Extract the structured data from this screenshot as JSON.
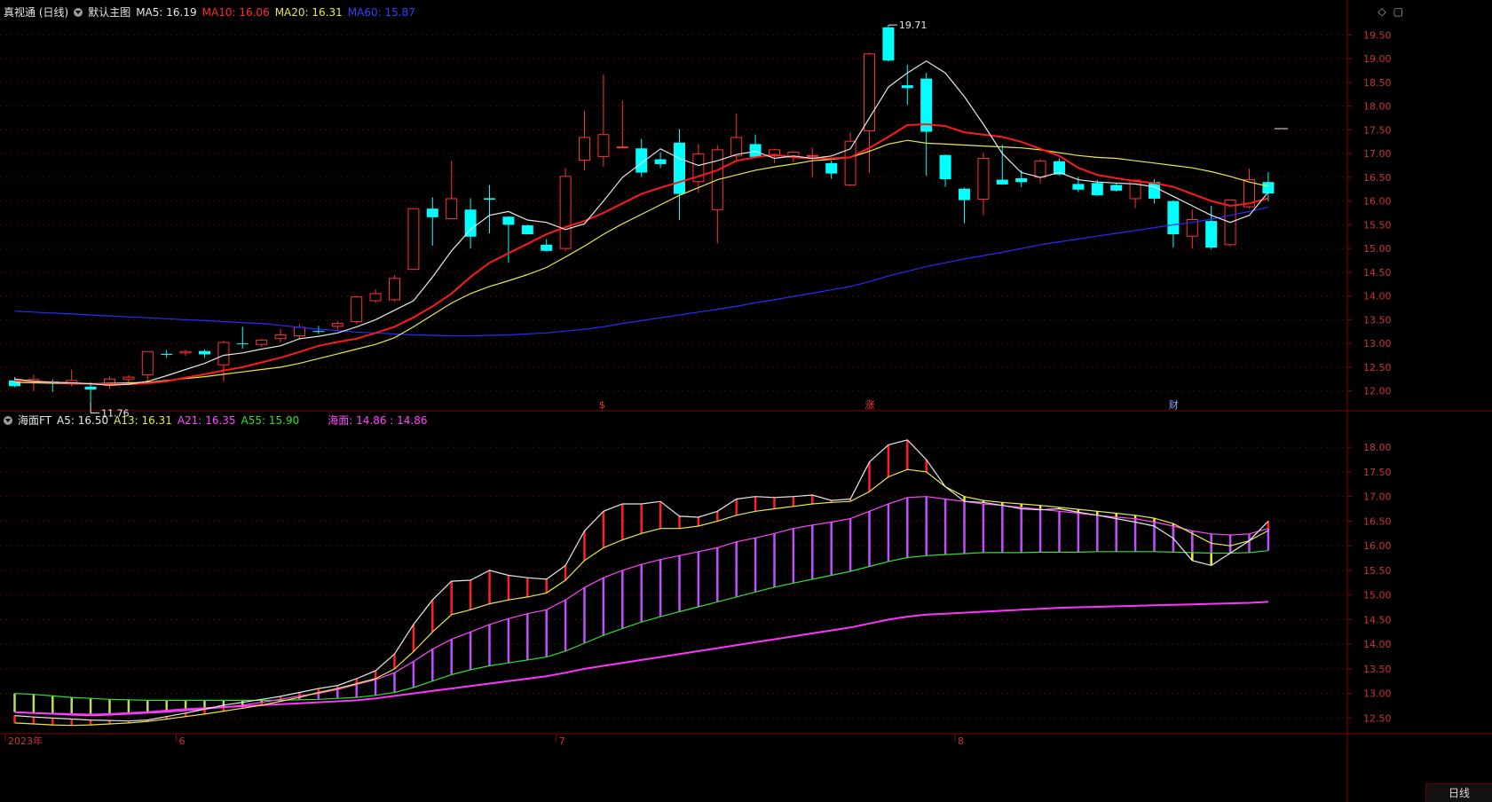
{
  "top_panel": {
    "title": "真视通 (日线)",
    "template": "默认主图",
    "ma": [
      {
        "label": "MA5:",
        "value": "16.19",
        "color": "#e6e6e6"
      },
      {
        "label": "MA10:",
        "value": "16.06",
        "color": "#ff2a2a"
      },
      {
        "label": "MA20:",
        "value": "16.31",
        "color": "#e8e84a"
      },
      {
        "label": "MA60:",
        "value": "15.87",
        "color": "#2a2aff"
      }
    ],
    "high_label": "19.71",
    "low_label": "11.76",
    "markers": [
      "$",
      "涨",
      "财"
    ],
    "yticks": [
      "19.50",
      "19.00",
      "18.50",
      "18.00",
      "17.50",
      "17.00",
      "16.50",
      "16.00",
      "15.50",
      "15.00",
      "14.50",
      "14.00",
      "13.50",
      "13.00",
      "12.50",
      "12.00"
    ]
  },
  "bottom_panel": {
    "title": "海面FT",
    "indicators": [
      {
        "label": "A5:",
        "value": "16.50",
        "color": "#e6e6e6"
      },
      {
        "label": "A13:",
        "value": "16.31",
        "color": "#e8e84a"
      },
      {
        "label": "A21:",
        "value": "16.35",
        "color": "#ff44ff"
      },
      {
        "label": "A55:",
        "value": "15.90",
        "color": "#33dd33"
      }
    ],
    "extra": {
      "label": "海面:",
      "value": "14.86 : 14.86",
      "color": "#ff44ff"
    },
    "yticks": [
      "18.00",
      "17.50",
      "17.00",
      "16.50",
      "16.00",
      "15.50",
      "15.00",
      "14.50",
      "14.00",
      "13.50",
      "13.00",
      "12.50"
    ]
  },
  "xaxis": [
    "2023年",
    "6",
    "7",
    "8"
  ],
  "period_label": "日线",
  "icons": [
    "diamond-icon",
    "window-icon"
  ],
  "chart_data": {
    "type": "candlestick",
    "title": "真视通 (日线)",
    "candles": [
      {
        "o": 12.22,
        "h": 12.29,
        "l": 12.08,
        "c": 12.1
      },
      {
        "o": 12.2,
        "h": 12.34,
        "l": 12.0,
        "c": 12.24
      },
      {
        "o": 12.2,
        "h": 12.24,
        "l": 11.98,
        "c": 12.18
      },
      {
        "o": 12.16,
        "h": 12.45,
        "l": 12.1,
        "c": 12.22
      },
      {
        "o": 12.09,
        "h": 12.18,
        "l": 11.76,
        "c": 12.03
      },
      {
        "o": 12.12,
        "h": 12.3,
        "l": 12.04,
        "c": 12.25
      },
      {
        "o": 12.24,
        "h": 12.33,
        "l": 12.12,
        "c": 12.29
      },
      {
        "o": 12.34,
        "h": 12.83,
        "l": 12.14,
        "c": 12.83
      },
      {
        "o": 12.78,
        "h": 12.86,
        "l": 12.7,
        "c": 12.76
      },
      {
        "o": 12.8,
        "h": 12.86,
        "l": 12.74,
        "c": 12.83
      },
      {
        "o": 12.84,
        "h": 12.87,
        "l": 12.7,
        "c": 12.77
      },
      {
        "o": 12.55,
        "h": 13.06,
        "l": 12.2,
        "c": 13.02
      },
      {
        "o": 13.0,
        "h": 13.35,
        "l": 12.89,
        "c": 12.99
      },
      {
        "o": 12.98,
        "h": 13.1,
        "l": 12.93,
        "c": 13.07
      },
      {
        "o": 13.1,
        "h": 13.3,
        "l": 13.02,
        "c": 13.18
      },
      {
        "o": 13.16,
        "h": 13.4,
        "l": 13.1,
        "c": 13.34
      },
      {
        "o": 13.26,
        "h": 13.37,
        "l": 13.2,
        "c": 13.25
      },
      {
        "o": 13.36,
        "h": 13.47,
        "l": 13.27,
        "c": 13.42
      },
      {
        "o": 13.46,
        "h": 14.0,
        "l": 13.4,
        "c": 13.98
      },
      {
        "o": 13.9,
        "h": 14.14,
        "l": 13.86,
        "c": 14.05
      },
      {
        "o": 13.92,
        "h": 14.44,
        "l": 13.88,
        "c": 14.37
      },
      {
        "o": 14.56,
        "h": 15.84,
        "l": 14.55,
        "c": 15.84
      },
      {
        "o": 15.84,
        "h": 16.08,
        "l": 15.06,
        "c": 15.66
      },
      {
        "o": 15.63,
        "h": 16.85,
        "l": 15.64,
        "c": 16.05
      },
      {
        "o": 15.82,
        "h": 16.06,
        "l": 15.0,
        "c": 15.25
      },
      {
        "o": 16.06,
        "h": 16.34,
        "l": 15.32,
        "c": 16.03
      },
      {
        "o": 15.67,
        "h": 15.68,
        "l": 14.7,
        "c": 15.5
      },
      {
        "o": 15.49,
        "h": 15.5,
        "l": 15.34,
        "c": 15.3
      },
      {
        "o": 15.08,
        "h": 15.2,
        "l": 14.95,
        "c": 14.95
      },
      {
        "o": 15.0,
        "h": 16.7,
        "l": 14.94,
        "c": 16.52
      },
      {
        "o": 16.86,
        "h": 17.9,
        "l": 16.65,
        "c": 17.34
      },
      {
        "o": 16.94,
        "h": 18.67,
        "l": 16.72,
        "c": 17.4
      },
      {
        "o": 17.13,
        "h": 18.12,
        "l": 17.12,
        "c": 17.14
      },
      {
        "o": 17.11,
        "h": 17.31,
        "l": 16.51,
        "c": 16.6
      },
      {
        "o": 16.88,
        "h": 17.03,
        "l": 16.7,
        "c": 16.78
      },
      {
        "o": 17.23,
        "h": 17.52,
        "l": 15.6,
        "c": 16.15
      },
      {
        "o": 16.41,
        "h": 17.2,
        "l": 16.18,
        "c": 16.99
      },
      {
        "o": 15.82,
        "h": 17.18,
        "l": 15.11,
        "c": 17.08
      },
      {
        "o": 16.95,
        "h": 17.85,
        "l": 16.83,
        "c": 17.34
      },
      {
        "o": 17.2,
        "h": 17.4,
        "l": 16.92,
        "c": 16.93
      },
      {
        "o": 16.95,
        "h": 17.1,
        "l": 16.8,
        "c": 17.08
      },
      {
        "o": 16.93,
        "h": 17.05,
        "l": 16.82,
        "c": 17.03
      },
      {
        "o": 16.96,
        "h": 17.12,
        "l": 16.5,
        "c": 16.96
      },
      {
        "o": 16.8,
        "h": 16.85,
        "l": 16.47,
        "c": 16.58
      },
      {
        "o": 16.34,
        "h": 17.45,
        "l": 16.31,
        "c": 17.26
      },
      {
        "o": 17.48,
        "h": 19.13,
        "l": 16.59,
        "c": 19.1
      },
      {
        "o": 19.66,
        "h": 19.71,
        "l": 18.94,
        "c": 18.96
      },
      {
        "o": 18.44,
        "h": 18.87,
        "l": 18.02,
        "c": 18.38
      },
      {
        "o": 18.58,
        "h": 18.7,
        "l": 16.53,
        "c": 17.46
      },
      {
        "o": 16.97,
        "h": 16.98,
        "l": 16.3,
        "c": 16.46
      },
      {
        "o": 16.26,
        "h": 16.28,
        "l": 15.53,
        "c": 16.02
      },
      {
        "o": 16.04,
        "h": 17.02,
        "l": 15.7,
        "c": 16.9
      },
      {
        "o": 16.45,
        "h": 17.19,
        "l": 16.34,
        "c": 16.35
      },
      {
        "o": 16.48,
        "h": 16.65,
        "l": 16.3,
        "c": 16.4
      },
      {
        "o": 16.5,
        "h": 16.88,
        "l": 16.37,
        "c": 16.84
      },
      {
        "o": 16.84,
        "h": 16.9,
        "l": 16.54,
        "c": 16.56
      },
      {
        "o": 16.36,
        "h": 16.51,
        "l": 16.19,
        "c": 16.24
      },
      {
        "o": 16.38,
        "h": 16.45,
        "l": 16.11,
        "c": 16.12
      },
      {
        "o": 16.34,
        "h": 16.38,
        "l": 16.2,
        "c": 16.22
      },
      {
        "o": 16.05,
        "h": 16.45,
        "l": 15.85,
        "c": 16.44
      },
      {
        "o": 16.4,
        "h": 16.46,
        "l": 15.95,
        "c": 16.05
      },
      {
        "o": 16.0,
        "h": 16.02,
        "l": 15.02,
        "c": 15.3
      },
      {
        "o": 15.26,
        "h": 15.82,
        "l": 15.0,
        "c": 15.61
      },
      {
        "o": 15.58,
        "h": 15.9,
        "l": 14.98,
        "c": 15.02
      },
      {
        "o": 15.08,
        "h": 16.02,
        "l": 15.04,
        "c": 16.02
      },
      {
        "o": 15.88,
        "h": 16.68,
        "l": 15.85,
        "c": 16.45
      },
      {
        "o": 16.4,
        "h": 16.61,
        "l": 16.0,
        "c": 16.16
      }
    ],
    "ma5": [
      12.25,
      12.2,
      12.18,
      12.17,
      12.15,
      12.12,
      12.14,
      12.2,
      12.32,
      12.45,
      12.58,
      12.75,
      12.8,
      12.88,
      12.95,
      13.1,
      13.15,
      13.22,
      13.35,
      13.5,
      13.7,
      13.9,
      14.4,
      14.95,
      15.4,
      15.7,
      15.78,
      15.6,
      15.55,
      15.4,
      15.52,
      16.0,
      16.5,
      16.8,
      17.1,
      16.9,
      16.75,
      16.85,
      16.98,
      17.05,
      16.9,
      16.95,
      16.9,
      16.95,
      17.1,
      17.75,
      18.4,
      18.7,
      18.95,
      18.7,
      18.2,
      17.62,
      17.0,
      16.6,
      16.5,
      16.6,
      16.45,
      16.4,
      16.38,
      16.36,
      16.3,
      16.1,
      15.9,
      15.7,
      15.55,
      15.7,
      16.19
    ],
    "ma10": [
      12.22,
      12.2,
      12.18,
      12.16,
      12.15,
      12.14,
      12.14,
      12.16,
      12.2,
      12.28,
      12.35,
      12.43,
      12.5,
      12.6,
      12.7,
      12.82,
      12.95,
      13.03,
      13.1,
      13.22,
      13.35,
      13.55,
      13.78,
      14.05,
      14.4,
      14.7,
      14.9,
      15.1,
      15.3,
      15.45,
      15.58,
      15.75,
      15.95,
      16.15,
      16.28,
      16.4,
      16.52,
      16.65,
      16.85,
      16.92,
      16.98,
      16.92,
      16.9,
      16.9,
      16.92,
      17.12,
      17.35,
      17.6,
      17.62,
      17.58,
      17.45,
      17.4,
      17.35,
      17.25,
      17.1,
      16.95,
      16.7,
      16.55,
      16.48,
      16.42,
      16.38,
      16.3,
      16.15,
      16.0,
      15.9,
      15.95,
      16.06
    ],
    "ma20": [
      12.18,
      12.17,
      12.16,
      12.15,
      12.15,
      12.16,
      12.17,
      12.18,
      12.22,
      12.26,
      12.3,
      12.35,
      12.4,
      12.45,
      12.5,
      12.58,
      12.68,
      12.78,
      12.88,
      12.98,
      13.12,
      13.35,
      13.6,
      13.85,
      14.05,
      14.2,
      14.32,
      14.45,
      14.6,
      14.82,
      15.05,
      15.3,
      15.52,
      15.72,
      15.92,
      16.12,
      16.28,
      16.45,
      16.55,
      16.65,
      16.72,
      16.78,
      16.85,
      16.88,
      16.92,
      17.05,
      17.2,
      17.28,
      17.22,
      17.2,
      17.18,
      17.16,
      17.14,
      17.12,
      17.08,
      17.02,
      16.96,
      16.92,
      16.9,
      16.85,
      16.8,
      16.75,
      16.7,
      16.62,
      16.52,
      16.4,
      16.31
    ],
    "ma60": [
      13.68,
      13.66,
      13.64,
      13.62,
      13.6,
      13.58,
      13.56,
      13.54,
      13.52,
      13.5,
      13.48,
      13.46,
      13.44,
      13.42,
      13.38,
      13.34,
      13.3,
      13.27,
      13.24,
      13.22,
      13.2,
      13.18,
      13.17,
      13.16,
      13.16,
      13.17,
      13.18,
      13.2,
      13.22,
      13.26,
      13.3,
      13.35,
      13.42,
      13.48,
      13.54,
      13.6,
      13.66,
      13.72,
      13.78,
      13.86,
      13.92,
      13.99,
      14.06,
      14.13,
      14.2,
      14.3,
      14.42,
      14.52,
      14.62,
      14.7,
      14.78,
      14.85,
      14.92,
      15.0,
      15.08,
      15.14,
      15.2,
      15.26,
      15.32,
      15.38,
      15.44,
      15.5,
      15.55,
      15.62,
      15.7,
      15.78,
      15.87
    ],
    "ft_a5": [
      12.55,
      12.52,
      12.5,
      12.48,
      12.46,
      12.45,
      12.44,
      12.46,
      12.53,
      12.6,
      12.68,
      12.76,
      12.82,
      12.88,
      12.94,
      13.02,
      13.1,
      13.16,
      13.3,
      13.46,
      13.8,
      14.4,
      14.9,
      15.28,
      15.3,
      15.5,
      15.4,
      15.35,
      15.32,
      15.6,
      16.3,
      16.7,
      16.85,
      16.85,
      16.9,
      16.6,
      16.58,
      16.7,
      16.95,
      17.0,
      16.98,
      17.0,
      17.03,
      16.92,
      16.95,
      17.7,
      18.05,
      18.15,
      17.75,
      17.2,
      16.9,
      16.88,
      16.82,
      16.75,
      16.73,
      16.75,
      16.68,
      16.62,
      16.55,
      16.48,
      16.4,
      16.15,
      15.7,
      15.6,
      15.85,
      16.1,
      16.5
    ],
    "ft_a13": [
      12.4,
      12.38,
      12.36,
      12.35,
      12.36,
      12.38,
      12.4,
      12.43,
      12.48,
      12.53,
      12.58,
      12.64,
      12.7,
      12.76,
      12.84,
      12.92,
      13.02,
      13.1,
      13.2,
      13.3,
      13.5,
      13.85,
      14.25,
      14.6,
      14.7,
      14.82,
      14.9,
      14.96,
      15.04,
      15.3,
      15.7,
      15.96,
      16.12,
      16.25,
      16.35,
      16.35,
      16.4,
      16.5,
      16.62,
      16.7,
      16.75,
      16.8,
      16.85,
      16.88,
      16.9,
      17.1,
      17.4,
      17.55,
      17.5,
      17.2,
      17.0,
      16.92,
      16.88,
      16.85,
      16.82,
      16.78,
      16.74,
      16.7,
      16.66,
      16.62,
      16.56,
      16.45,
      16.25,
      16.05,
      16.0,
      16.1,
      16.31
    ],
    "ft_a21": [
      12.62,
      12.6,
      12.58,
      12.56,
      12.55,
      12.56,
      12.58,
      12.6,
      12.62,
      12.65,
      12.68,
      12.72,
      12.76,
      12.82,
      12.88,
      12.95,
      13.0,
      13.08,
      13.18,
      13.28,
      13.42,
      13.65,
      13.9,
      14.1,
      14.25,
      14.4,
      14.52,
      14.62,
      14.7,
      14.9,
      15.15,
      15.35,
      15.5,
      15.62,
      15.72,
      15.8,
      15.88,
      15.96,
      16.08,
      16.16,
      16.25,
      16.35,
      16.42,
      16.48,
      16.55,
      16.7,
      16.85,
      16.98,
      17.0,
      16.95,
      16.9,
      16.85,
      16.82,
      16.78,
      16.74,
      16.7,
      16.66,
      16.62,
      16.58,
      16.55,
      16.48,
      16.4,
      16.3,
      16.24,
      16.22,
      16.24,
      16.35
    ],
    "ft_a55": [
      13.0,
      12.98,
      12.95,
      12.92,
      12.9,
      12.88,
      12.87,
      12.86,
      12.86,
      12.86,
      12.86,
      12.86,
      12.86,
      12.86,
      12.86,
      12.87,
      12.88,
      12.9,
      12.92,
      12.96,
      13.02,
      13.12,
      13.25,
      13.38,
      13.48,
      13.56,
      13.62,
      13.68,
      13.74,
      13.86,
      14.02,
      14.18,
      14.32,
      14.45,
      14.56,
      14.66,
      14.76,
      14.86,
      14.96,
      15.06,
      15.16,
      15.24,
      15.32,
      15.4,
      15.48,
      15.58,
      15.68,
      15.76,
      15.8,
      15.82,
      15.84,
      15.86,
      15.86,
      15.86,
      15.87,
      15.87,
      15.87,
      15.88,
      15.88,
      15.88,
      15.88,
      15.87,
      15.86,
      15.85,
      15.85,
      15.86,
      15.9
    ],
    "ft_haimian": [
      12.62,
      12.6,
      12.59,
      12.58,
      12.57,
      12.58,
      12.6,
      12.62,
      12.65,
      12.68,
      12.7,
      12.72,
      12.74,
      12.76,
      12.78,
      12.8,
      12.82,
      12.84,
      12.86,
      12.9,
      12.95,
      13.0,
      13.05,
      13.1,
      13.15,
      13.2,
      13.25,
      13.3,
      13.35,
      13.42,
      13.5,
      13.56,
      13.62,
      13.68,
      13.74,
      13.8,
      13.86,
      13.92,
      13.98,
      14.04,
      14.1,
      14.16,
      14.22,
      14.28,
      14.34,
      14.42,
      14.5,
      14.56,
      14.6,
      14.62,
      14.64,
      14.66,
      14.68,
      14.7,
      14.72,
      14.74,
      14.75,
      14.76,
      14.77,
      14.78,
      14.79,
      14.8,
      14.81,
      14.82,
      14.83,
      14.84,
      14.86
    ],
    "top_ylim": [
      11.6,
      19.9
    ],
    "bottom_ylim": [
      12.2,
      18.4
    ]
  }
}
